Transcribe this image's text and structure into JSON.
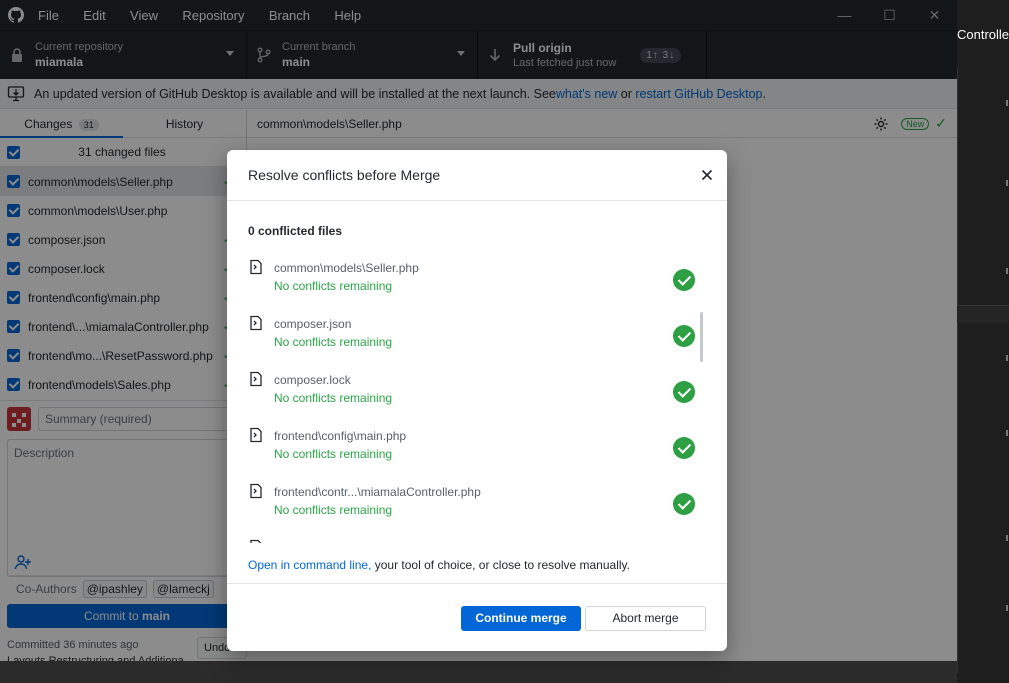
{
  "window": {
    "menu": [
      "File",
      "Edit",
      "View",
      "Repository",
      "Branch",
      "Help"
    ],
    "controls": {
      "minimize": "—",
      "maximize": "☐",
      "close": "✕"
    }
  },
  "toolbar": {
    "repo_label": "Current repository",
    "repo_value": "miamala",
    "branch_label": "Current branch",
    "branch_value": "main",
    "pull_label": "Pull origin",
    "pull_sub": "Last fetched just now",
    "pull_badge": "1↑ 3↓"
  },
  "banner": {
    "text_before": "An updated version of GitHub Desktop is available and will be installed at the next launch. See ",
    "link1": "what's new",
    "text_mid": " or ",
    "link2": "restart GitHub Desktop",
    "text_after": "."
  },
  "sidebar": {
    "tab_changes": "Changes",
    "tab_changes_count": "31",
    "tab_history": "History",
    "changed_files_label": "31 changed files",
    "files": [
      {
        "name": "common\\models\\Seller.php",
        "status": "✓"
      },
      {
        "name": "common\\models\\User.php",
        "status": "!"
      },
      {
        "name": "composer.json",
        "status": "✓"
      },
      {
        "name": "composer.lock",
        "status": "✓"
      },
      {
        "name": "frontend\\config\\main.php",
        "status": "✓"
      },
      {
        "name": "frontend\\...\\miamalaController.php",
        "status": "✓"
      },
      {
        "name": "frontend\\mo...\\ResetPassword.php",
        "status": "✓"
      },
      {
        "name": "frontend\\models\\Sales.php",
        "status": "✓"
      }
    ],
    "summary_placeholder": "Summary (required)",
    "description_placeholder": "Description",
    "coauthors_label": "Co-Authors",
    "coauthors": [
      "@ipashley",
      "@lameckj"
    ],
    "commit_prefix": "Commit to ",
    "commit_branch": "main",
    "last_commit_time": "Committed 36 minutes ago",
    "last_commit_msg": "Layouts Restructuring and Additiona...",
    "undo_label": "Undo"
  },
  "main": {
    "path": "common\\models\\Seller.php",
    "new_badge": "New"
  },
  "background": {
    "right_tab": "Controlle"
  },
  "dialog": {
    "title": "Resolve conflicts before Merge",
    "conflict_count": "0 conflicted files",
    "files": [
      {
        "name": "common\\models\\Seller.php",
        "status": "No conflicts remaining"
      },
      {
        "name": "composer.json",
        "status": "No conflicts remaining"
      },
      {
        "name": "composer.lock",
        "status": "No conflicts remaining"
      },
      {
        "name": "frontend\\config\\main.php",
        "status": "No conflicts remaining"
      },
      {
        "name": "frontend\\contr...\\miamalaController.php",
        "status": "No conflicts remaining"
      }
    ],
    "hint_link": "Open in command line,",
    "hint_text": " your tool of choice, or close to resolve manually.",
    "continue_label": "Continue merge",
    "abort_label": "Abort merge"
  },
  "colors": {
    "accent": "#0366d6",
    "success": "#2ea043",
    "toolbar_bg": "#24292e"
  }
}
